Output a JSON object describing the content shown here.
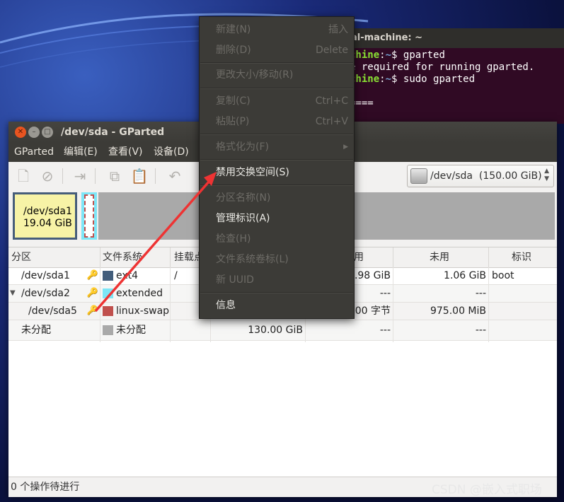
{
  "terminal": {
    "title": "al-machine: ~",
    "lines": [
      {
        "host": "chine",
        "sep": ":",
        "path": "~",
        "cmd": "$ gparted"
      },
      {
        "text": "e required for running gparted."
      },
      {
        "host": "chine",
        "sep": ":",
        "path": "~",
        "cmd": "$ sudo gparted"
      },
      {
        "text": "===="
      }
    ]
  },
  "gparted": {
    "title": "/dev/sda - GParted",
    "menu": [
      "GParted",
      "编辑(E)",
      "查看(V)",
      "设备(D)"
    ],
    "device_selector": "/dev/sda  (150.00 GiB)",
    "disk_map": {
      "partition_label": "/dev/sda1",
      "partition_size": "19.04 GiB"
    },
    "columns": [
      "分区",
      "文件系统",
      "挂载点",
      "用",
      "未用",
      "标识"
    ],
    "rows": [
      {
        "partition": "/dev/sda1",
        "fs": "ext4",
        "fs_color": "#425d7b",
        "mount": "/",
        "size": "",
        "used": "7.98 GiB",
        "unused": "1.06 GiB",
        "flags": "boot"
      },
      {
        "partition": "/dev/sda2",
        "fs": "extended",
        "fs_color": "#7de6f7",
        "mount": "",
        "size": "",
        "used": "---",
        "unused": "---",
        "flags": ""
      },
      {
        "partition": "/dev/sda5",
        "fs": "linux-swap",
        "fs_color": "#c0504d",
        "mount": "",
        "size": "",
        "used": ".00 字节",
        "unused": "975.00 MiB",
        "flags": ""
      },
      {
        "partition": "未分配",
        "fs": "未分配",
        "fs_color": "#a9a9a9",
        "mount": "",
        "size": "130.00 GiB",
        "used": "---",
        "unused": "---",
        "flags": ""
      }
    ],
    "status": "0 个操作待进行"
  },
  "context_menu": {
    "items": [
      {
        "label": "新建(N)",
        "accel": "插入",
        "enabled": false
      },
      {
        "label": "删除(D)",
        "accel": "Delete",
        "enabled": false
      },
      {
        "label": "更改大小/移动(R)",
        "accel": "",
        "enabled": false
      },
      {
        "label": "复制(C)",
        "accel": "Ctrl+C",
        "enabled": false
      },
      {
        "label": "粘贴(P)",
        "accel": "Ctrl+V",
        "enabled": false
      },
      {
        "label": "格式化为(F)",
        "accel": "",
        "enabled": false
      },
      {
        "label": "禁用交换空间(S)",
        "accel": "",
        "enabled": true
      },
      {
        "label": "分区名称(N)",
        "accel": "",
        "enabled": false
      },
      {
        "label": "管理标识(A)",
        "accel": "",
        "enabled": true
      },
      {
        "label": "检查(H)",
        "accel": "",
        "enabled": false
      },
      {
        "label": "文件系统卷标(L)",
        "accel": "",
        "enabled": false
      },
      {
        "label": "新 UUID",
        "accel": "",
        "enabled": false
      },
      {
        "label": "信息",
        "accel": "",
        "enabled": true
      }
    ]
  },
  "watermark": "CSDN @嵌入式职场",
  "colors": {
    "accent": "#e95420",
    "menu_bg": "#3c3b37",
    "arrow": "#ee3333"
  }
}
